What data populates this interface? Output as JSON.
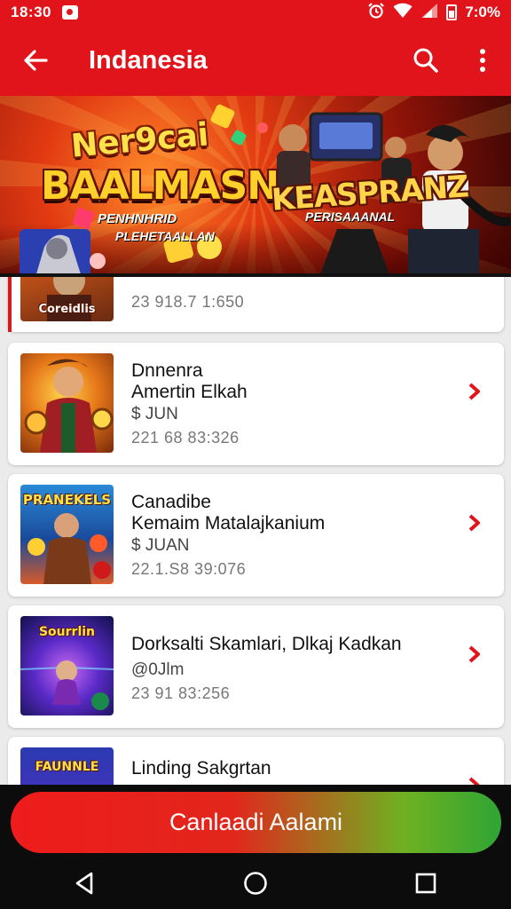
{
  "status_bar": {
    "time": "18:30",
    "battery": "7:0%",
    "icons": [
      "notification-icon",
      "alarm-icon",
      "wifi-icon",
      "signal-icon",
      "battery-icon"
    ]
  },
  "app_bar": {
    "title": "Indanesia",
    "icons": [
      "back-arrow-icon",
      "search-icon",
      "more-vert-icon"
    ]
  },
  "banner": {
    "title_1": "Ner9cai",
    "title_2": "BAALMASN",
    "sub_1": "PENHNHRID",
    "sub_2": "PLEHETAALLAN",
    "title_3": "KEASPRANZ",
    "sub_3": "PERISAAANAL"
  },
  "list": {
    "items": [
      {
        "thumb_label": "Coreidlis",
        "timestamp": "23 918.7 1:650",
        "active": true
      },
      {
        "title": "Dnnenra",
        "subtitle": "Amertin Elkah",
        "meta": "$ JUN",
        "timestamp": "221 68 83:326"
      },
      {
        "thumb_label": "PRANEKELS",
        "title": "Canadibe",
        "subtitle": "Kemaim Matalajkanium",
        "meta": "$ JUAN",
        "timestamp": "22.1.S8 39:076"
      },
      {
        "thumb_label": "Sourrlin",
        "title": "Dorksalti Skamlari, Dlkaj Kadkan",
        "meta": "@0Jlm",
        "timestamp": "23 91 83:256"
      },
      {
        "thumb_label": "FAUNNLE",
        "title": "Linding Sakgrtan"
      }
    ]
  },
  "cta": {
    "label": "Canlaadi Aalami"
  },
  "nav": {
    "icons": [
      "nav-back-icon",
      "nav-home-icon",
      "nav-recents-icon"
    ]
  },
  "colors": {
    "primary": "#e2141b",
    "cta_start": "#ee1c1c",
    "cta_end": "#2fa534",
    "chevron": "#e2141b"
  }
}
